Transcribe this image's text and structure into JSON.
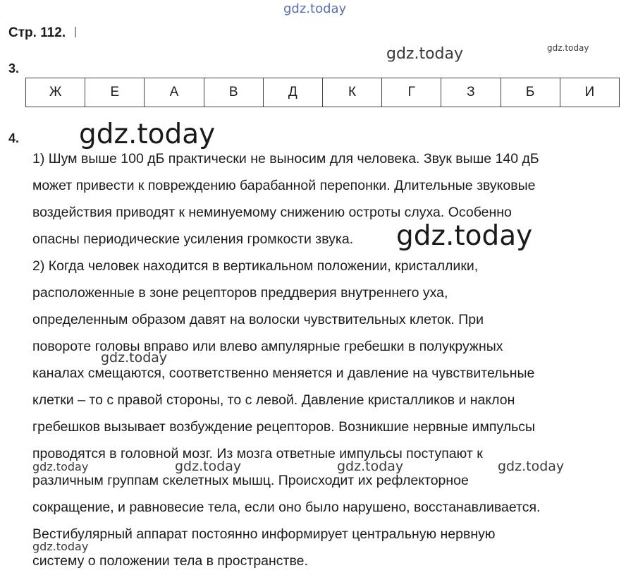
{
  "watermarks": {
    "top": "gdz.today",
    "mid": "gdz.today",
    "small_right": "gdz.today",
    "big1": "gdz.today",
    "big2": "gdz.today",
    "inline1": "gdz.today",
    "row1": "gdz.today",
    "row2": "gdz.today",
    "row3": "gdz.today",
    "row4": "gdz.today",
    "bottom": "gdz.today"
  },
  "header": {
    "page_label": "Стр. 112."
  },
  "task3": {
    "number": "3.",
    "answers": [
      "Ж",
      "Е",
      "А",
      "В",
      "Д",
      "К",
      "Г",
      "З",
      "Б",
      "И"
    ]
  },
  "task4": {
    "number": "4.",
    "lines": [
      "1) Шум выше 100 дБ практически не выносим для человека. Звук выше 140 дБ",
      "может привести к повреждению барабанной перепонки. Длительные звуковые",
      "воздействия приводят к неминуемому снижению остроты слуха. Особенно",
      "опасны периодические усиления громкости звука.",
      "2) Когда человек находится в вертикальном положении, кристаллики,",
      "расположенные в зоне рецепторов преддверия внутреннего уха,",
      "определенным образом давят на волоски чувствительных клеток. При",
      "повороте головы вправо или влево ампулярные гребешки в полукружных",
      "каналах смещаются, соответственно меняется и давление на чувствительные",
      "клетки – то с правой стороны, то с левой. Давление кристалликов и наклон",
      "гребешков вызывает возбуждение рецепторов. Возникшие нервные импульсы",
      "проводятся в головной мозг. Из мозга ответные импульсы поступают к",
      "различным группам скелетных мышц. Происходит их рефлекторное",
      "сокращение, и равновесие тела, если оно было нарушено, восстанавливается.",
      "Вестибулярный аппарат постоянно информирует центральную нервную",
      "систему о положении тела в пространстве."
    ]
  }
}
